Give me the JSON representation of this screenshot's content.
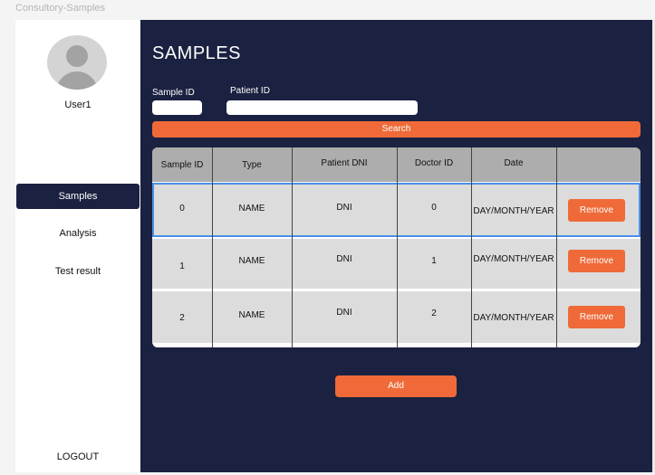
{
  "frame_label": "Consultory-Samples",
  "sidebar": {
    "username": "User1",
    "items": [
      {
        "label": "Samples",
        "active": true
      },
      {
        "label": "Analysis",
        "active": false
      },
      {
        "label": "Test result",
        "active": false
      }
    ],
    "logout_label": "LOGOUT"
  },
  "main": {
    "title": "SAMPLES",
    "filters": {
      "sample_id_label": "Sample ID",
      "patient_id_label": "Patient ID",
      "search_label": "Search"
    },
    "table": {
      "headers": [
        "Sample ID",
        "Type",
        "Patient DNI",
        "Doctor ID",
        "Date"
      ],
      "rows": [
        {
          "sample_id": "0",
          "type": "NAME",
          "patient_dni": "DNI",
          "doctor_id": "0",
          "date": "DAY/MONTH/YEAR",
          "action": "Remove"
        },
        {
          "sample_id": "1",
          "type": "NAME",
          "patient_dni": "DNI",
          "doctor_id": "1",
          "date": "DAY/MONTH/YEAR",
          "action": "Remove"
        },
        {
          "sample_id": "2",
          "type": "NAME",
          "patient_dni": "DNI",
          "doctor_id": "2",
          "date": "DAY/MONTH/YEAR",
          "action": "Remove"
        }
      ]
    },
    "add_label": "Add"
  },
  "colors": {
    "navy": "#1b2140",
    "accent": "#ef6a38",
    "selection": "#4a8fe8"
  },
  "icons": {
    "avatar": "user-avatar-icon"
  }
}
